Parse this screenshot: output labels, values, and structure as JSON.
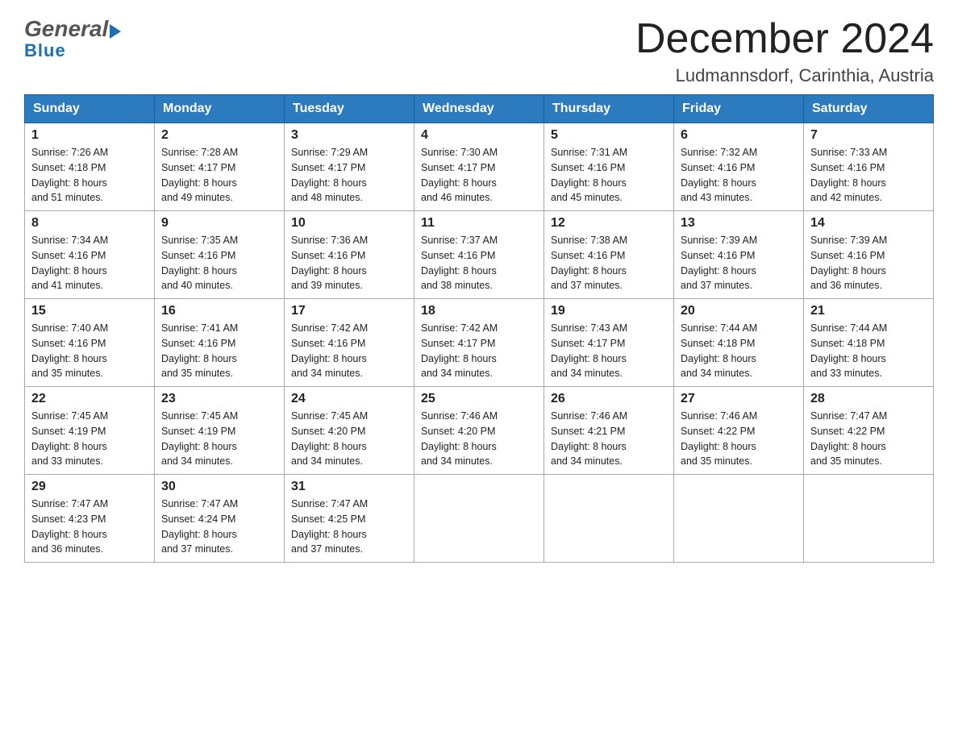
{
  "header": {
    "logo_general": "General",
    "logo_blue": "Blue",
    "month_title": "December 2024",
    "location": "Ludmannsdorf, Carinthia, Austria"
  },
  "days_of_week": [
    "Sunday",
    "Monday",
    "Tuesday",
    "Wednesday",
    "Thursday",
    "Friday",
    "Saturday"
  ],
  "weeks": [
    [
      {
        "day": "1",
        "sunrise": "Sunrise: 7:26 AM",
        "sunset": "Sunset: 4:18 PM",
        "daylight": "Daylight: 8 hours",
        "daylight2": "and 51 minutes."
      },
      {
        "day": "2",
        "sunrise": "Sunrise: 7:28 AM",
        "sunset": "Sunset: 4:17 PM",
        "daylight": "Daylight: 8 hours",
        "daylight2": "and 49 minutes."
      },
      {
        "day": "3",
        "sunrise": "Sunrise: 7:29 AM",
        "sunset": "Sunset: 4:17 PM",
        "daylight": "Daylight: 8 hours",
        "daylight2": "and 48 minutes."
      },
      {
        "day": "4",
        "sunrise": "Sunrise: 7:30 AM",
        "sunset": "Sunset: 4:17 PM",
        "daylight": "Daylight: 8 hours",
        "daylight2": "and 46 minutes."
      },
      {
        "day": "5",
        "sunrise": "Sunrise: 7:31 AM",
        "sunset": "Sunset: 4:16 PM",
        "daylight": "Daylight: 8 hours",
        "daylight2": "and 45 minutes."
      },
      {
        "day": "6",
        "sunrise": "Sunrise: 7:32 AM",
        "sunset": "Sunset: 4:16 PM",
        "daylight": "Daylight: 8 hours",
        "daylight2": "and 43 minutes."
      },
      {
        "day": "7",
        "sunrise": "Sunrise: 7:33 AM",
        "sunset": "Sunset: 4:16 PM",
        "daylight": "Daylight: 8 hours",
        "daylight2": "and 42 minutes."
      }
    ],
    [
      {
        "day": "8",
        "sunrise": "Sunrise: 7:34 AM",
        "sunset": "Sunset: 4:16 PM",
        "daylight": "Daylight: 8 hours",
        "daylight2": "and 41 minutes."
      },
      {
        "day": "9",
        "sunrise": "Sunrise: 7:35 AM",
        "sunset": "Sunset: 4:16 PM",
        "daylight": "Daylight: 8 hours",
        "daylight2": "and 40 minutes."
      },
      {
        "day": "10",
        "sunrise": "Sunrise: 7:36 AM",
        "sunset": "Sunset: 4:16 PM",
        "daylight": "Daylight: 8 hours",
        "daylight2": "and 39 minutes."
      },
      {
        "day": "11",
        "sunrise": "Sunrise: 7:37 AM",
        "sunset": "Sunset: 4:16 PM",
        "daylight": "Daylight: 8 hours",
        "daylight2": "and 38 minutes."
      },
      {
        "day": "12",
        "sunrise": "Sunrise: 7:38 AM",
        "sunset": "Sunset: 4:16 PM",
        "daylight": "Daylight: 8 hours",
        "daylight2": "and 37 minutes."
      },
      {
        "day": "13",
        "sunrise": "Sunrise: 7:39 AM",
        "sunset": "Sunset: 4:16 PM",
        "daylight": "Daylight: 8 hours",
        "daylight2": "and 37 minutes."
      },
      {
        "day": "14",
        "sunrise": "Sunrise: 7:39 AM",
        "sunset": "Sunset: 4:16 PM",
        "daylight": "Daylight: 8 hours",
        "daylight2": "and 36 minutes."
      }
    ],
    [
      {
        "day": "15",
        "sunrise": "Sunrise: 7:40 AM",
        "sunset": "Sunset: 4:16 PM",
        "daylight": "Daylight: 8 hours",
        "daylight2": "and 35 minutes."
      },
      {
        "day": "16",
        "sunrise": "Sunrise: 7:41 AM",
        "sunset": "Sunset: 4:16 PM",
        "daylight": "Daylight: 8 hours",
        "daylight2": "and 35 minutes."
      },
      {
        "day": "17",
        "sunrise": "Sunrise: 7:42 AM",
        "sunset": "Sunset: 4:16 PM",
        "daylight": "Daylight: 8 hours",
        "daylight2": "and 34 minutes."
      },
      {
        "day": "18",
        "sunrise": "Sunrise: 7:42 AM",
        "sunset": "Sunset: 4:17 PM",
        "daylight": "Daylight: 8 hours",
        "daylight2": "and 34 minutes."
      },
      {
        "day": "19",
        "sunrise": "Sunrise: 7:43 AM",
        "sunset": "Sunset: 4:17 PM",
        "daylight": "Daylight: 8 hours",
        "daylight2": "and 34 minutes."
      },
      {
        "day": "20",
        "sunrise": "Sunrise: 7:44 AM",
        "sunset": "Sunset: 4:18 PM",
        "daylight": "Daylight: 8 hours",
        "daylight2": "and 34 minutes."
      },
      {
        "day": "21",
        "sunrise": "Sunrise: 7:44 AM",
        "sunset": "Sunset: 4:18 PM",
        "daylight": "Daylight: 8 hours",
        "daylight2": "and 33 minutes."
      }
    ],
    [
      {
        "day": "22",
        "sunrise": "Sunrise: 7:45 AM",
        "sunset": "Sunset: 4:19 PM",
        "daylight": "Daylight: 8 hours",
        "daylight2": "and 33 minutes."
      },
      {
        "day": "23",
        "sunrise": "Sunrise: 7:45 AM",
        "sunset": "Sunset: 4:19 PM",
        "daylight": "Daylight: 8 hours",
        "daylight2": "and 34 minutes."
      },
      {
        "day": "24",
        "sunrise": "Sunrise: 7:45 AM",
        "sunset": "Sunset: 4:20 PM",
        "daylight": "Daylight: 8 hours",
        "daylight2": "and 34 minutes."
      },
      {
        "day": "25",
        "sunrise": "Sunrise: 7:46 AM",
        "sunset": "Sunset: 4:20 PM",
        "daylight": "Daylight: 8 hours",
        "daylight2": "and 34 minutes."
      },
      {
        "day": "26",
        "sunrise": "Sunrise: 7:46 AM",
        "sunset": "Sunset: 4:21 PM",
        "daylight": "Daylight: 8 hours",
        "daylight2": "and 34 minutes."
      },
      {
        "day": "27",
        "sunrise": "Sunrise: 7:46 AM",
        "sunset": "Sunset: 4:22 PM",
        "daylight": "Daylight: 8 hours",
        "daylight2": "and 35 minutes."
      },
      {
        "day": "28",
        "sunrise": "Sunrise: 7:47 AM",
        "sunset": "Sunset: 4:22 PM",
        "daylight": "Daylight: 8 hours",
        "daylight2": "and 35 minutes."
      }
    ],
    [
      {
        "day": "29",
        "sunrise": "Sunrise: 7:47 AM",
        "sunset": "Sunset: 4:23 PM",
        "daylight": "Daylight: 8 hours",
        "daylight2": "and 36 minutes."
      },
      {
        "day": "30",
        "sunrise": "Sunrise: 7:47 AM",
        "sunset": "Sunset: 4:24 PM",
        "daylight": "Daylight: 8 hours",
        "daylight2": "and 37 minutes."
      },
      {
        "day": "31",
        "sunrise": "Sunrise: 7:47 AM",
        "sunset": "Sunset: 4:25 PM",
        "daylight": "Daylight: 8 hours",
        "daylight2": "and 37 minutes."
      },
      null,
      null,
      null,
      null
    ]
  ]
}
